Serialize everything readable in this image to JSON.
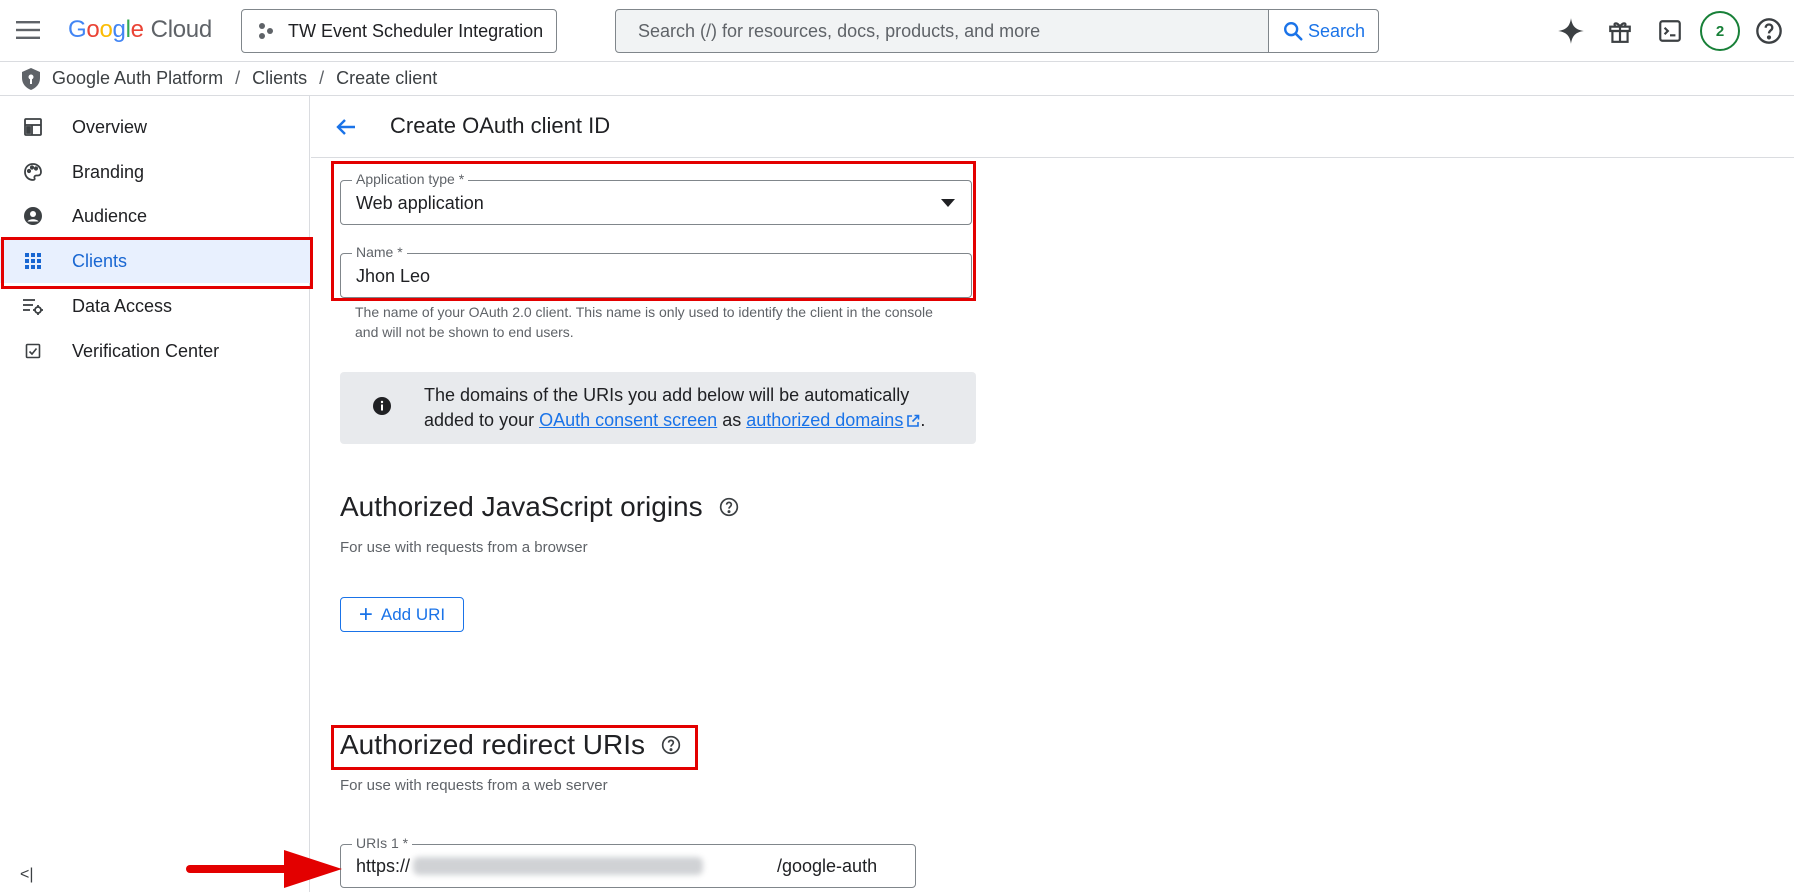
{
  "topbar": {
    "logo": {
      "g1": "G",
      "g2": "o",
      "g3": "o",
      "g4": "g",
      "g5": "l",
      "g6": "e",
      "product": "Cloud"
    },
    "project": "TW Event Scheduler Integration",
    "search_placeholder": "Search (/) for resources, docs, products, and more",
    "search_button": "Search",
    "avatar_count": "2"
  },
  "breadcrumb": {
    "items": [
      "Google Auth Platform",
      "Clients",
      "Create client"
    ],
    "separator": "/"
  },
  "sidebar": {
    "items": [
      {
        "label": "Overview",
        "icon": "dashboard-icon"
      },
      {
        "label": "Branding",
        "icon": "palette-icon"
      },
      {
        "label": "Audience",
        "icon": "person-icon"
      },
      {
        "label": "Clients",
        "icon": "apps-grid-icon",
        "active": true
      },
      {
        "label": "Data Access",
        "icon": "data-settings-icon"
      },
      {
        "label": "Verification Center",
        "icon": "checkbox-icon"
      }
    ],
    "collapse_label": "<|"
  },
  "main": {
    "title": "Create OAuth client ID",
    "app_type": {
      "label": "Application type *",
      "value": "Web application"
    },
    "name": {
      "label": "Name *",
      "value": "Jhon Leo",
      "hint": "The name of your OAuth 2.0 client. This name is only used to identify the client in the console and will not be shown to end users."
    },
    "info": {
      "text_before": "The domains of the URIs you add below will be automatically added to your ",
      "link1": "OAuth consent screen",
      "text_middle": " as ",
      "link2": "authorized domains",
      "text_after": "."
    },
    "js_origins": {
      "title": "Authorized JavaScript origins",
      "subtitle": "For use with requests from a browser",
      "add_button": "Add URI"
    },
    "redirect_uris": {
      "title": "Authorized redirect URIs",
      "subtitle": "For use with requests from a web server",
      "uri_label": "URIs 1 *",
      "uri_prefix": "https://",
      "uri_suffix": "/google-auth"
    }
  },
  "colors": {
    "accent": "#1a73e8",
    "active_bg": "#e8f0fe",
    "highlight": "#e30000",
    "avatar": "#188038"
  }
}
